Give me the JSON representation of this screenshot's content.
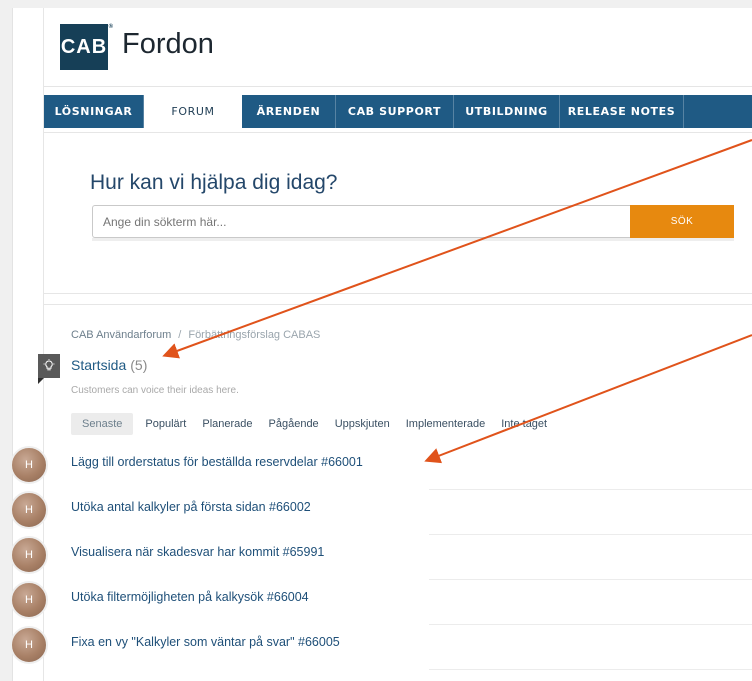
{
  "header": {
    "logo_text": "CAB",
    "logo_reg": "®",
    "site_title": "Fordon"
  },
  "nav": {
    "items": [
      {
        "label": "LÖSNINGAR",
        "active": false
      },
      {
        "label": "FORUM",
        "active": true
      },
      {
        "label": "ÄRENDEN",
        "active": false
      },
      {
        "label": "CAB SUPPORT",
        "active": false
      },
      {
        "label": "UTBILDNING",
        "active": false
      },
      {
        "label": "RELEASE NOTES",
        "active": false
      }
    ]
  },
  "search": {
    "heading": "Hur kan vi hjälpa dig idag?",
    "placeholder": "Ange din sökterm här...",
    "button_label": "SÖK"
  },
  "forum": {
    "breadcrumb": [
      "CAB Användarforum",
      "Förbättringsförslag CABAS"
    ],
    "breadcrumb_sep": "/",
    "title": "Startsida",
    "count": "(5)",
    "description": "Customers can voice their ideas here.",
    "filters": [
      "Senaste",
      "Populärt",
      "Planerade",
      "Pågående",
      "Uppskjuten",
      "Implementerade",
      "Inte taget"
    ],
    "ideas": [
      {
        "avatar": "H",
        "title": "Lägg till orderstatus för beställda reservdelar #66001"
      },
      {
        "avatar": "H",
        "title": "Utöka antal kalkyler på första sidan #66002"
      },
      {
        "avatar": "H",
        "title": "Visualisera när skadesvar har kommit #65991"
      },
      {
        "avatar": "H",
        "title": "Utöka filtermöjligheten på kalkysök #66004"
      },
      {
        "avatar": "H",
        "title": "Fixa en vy \"Kalkyler som väntar på svar\" #66005"
      }
    ]
  },
  "colors": {
    "nav_bg": "#1f5a84",
    "accent_orange": "#e7890f",
    "annotation_arrow": "#e0531b",
    "logo_bg": "#163f57"
  }
}
